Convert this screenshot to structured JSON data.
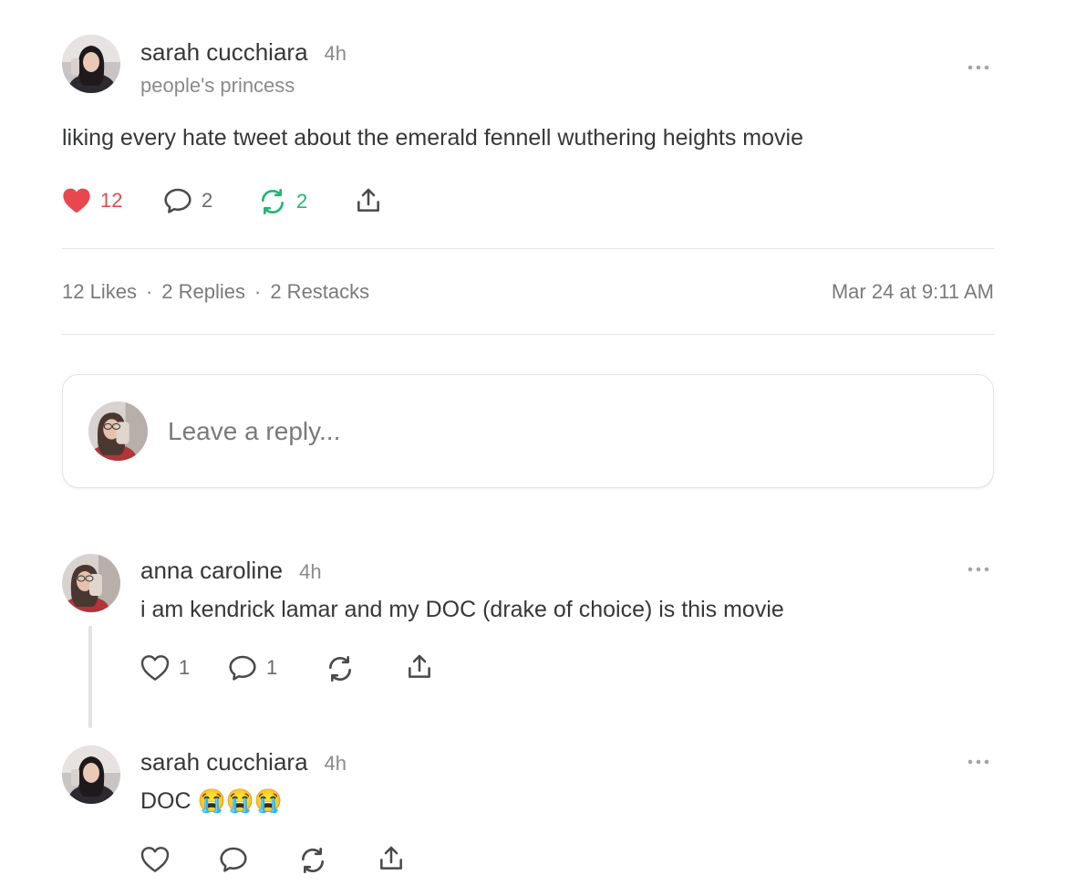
{
  "post": {
    "author": "sarah cucchiara",
    "time": "4h",
    "subtitle": "people's princess",
    "text": "liking every hate tweet about the emerald fennell wuthering heights movie",
    "likes": "12",
    "comments": "2",
    "restacks": "2",
    "stats": {
      "likes": "12 Likes",
      "replies": "2 Replies",
      "restacks": "2 Restacks",
      "separator": "·",
      "timestamp": "Mar 24 at 9:11 AM"
    }
  },
  "reply_box": {
    "placeholder": "Leave a reply..."
  },
  "comments": [
    {
      "author": "anna caroline",
      "time": "4h",
      "text": "i am kendrick lamar and my DOC (drake of choice) is this movie",
      "likes": "1",
      "comments": "1"
    },
    {
      "author": "sarah cucchiara",
      "time": "4h",
      "text": "DOC 😭😭😭"
    }
  ],
  "colors": {
    "like_active": "#e8474f",
    "restack_active": "#22b573",
    "icon_default": "#4a4a4a"
  },
  "icons": [
    "heart-icon",
    "comment-icon",
    "restack-icon",
    "share-icon",
    "more-icon"
  ]
}
